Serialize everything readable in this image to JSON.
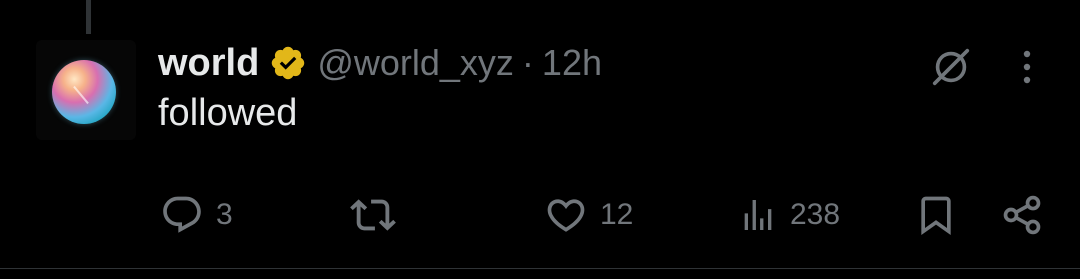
{
  "post": {
    "author_name": "world",
    "author_handle": "@world_xyz",
    "separator": "·",
    "timestamp": "12h",
    "text": "followed",
    "verified_color": "#E2B719"
  },
  "actions": {
    "reply_count": "3",
    "repost_count": "",
    "like_count": "12",
    "views_count": "238"
  },
  "icons": {
    "reply": "reply-icon",
    "repost": "repost-icon",
    "like": "heart-icon",
    "views": "views-icon",
    "bookmark": "bookmark-icon",
    "share": "share-icon",
    "grok": "grok-icon",
    "more": "more-icon",
    "verified": "verified-badge-icon"
  },
  "colors": {
    "background": "#000000",
    "primary_text": "#e7e9ea",
    "secondary_text": "#71767b",
    "divider": "#2f3336"
  }
}
